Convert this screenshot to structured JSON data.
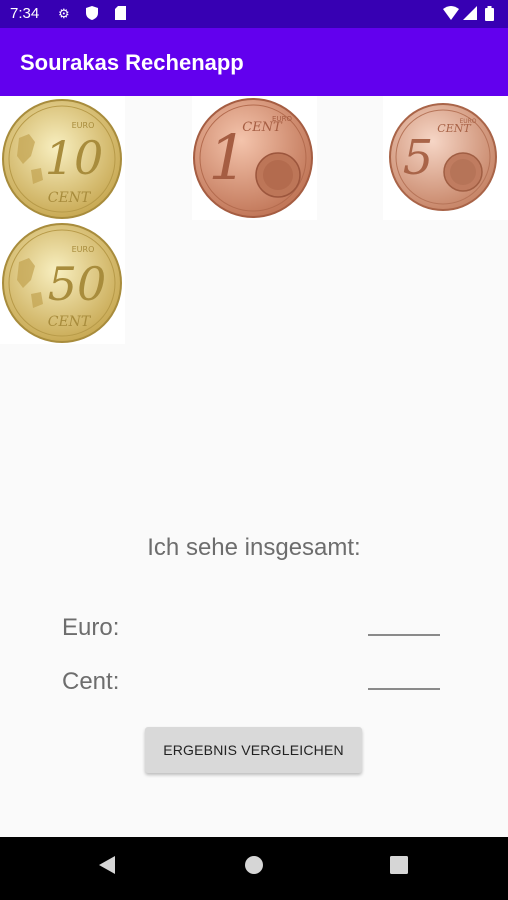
{
  "status_bar": {
    "time": "7:34",
    "left_icons": [
      "gear-icon",
      "shield-icon",
      "sd-card-icon"
    ],
    "right_icons": [
      "wifi-icon",
      "signal-icon",
      "battery-icon"
    ]
  },
  "app_bar": {
    "title": "Sourakas Rechenapp"
  },
  "coins": [
    {
      "label": "10",
      "sub": "CENT",
      "kind": "gold"
    },
    {
      "label": "1",
      "sub": "CENT",
      "kind": "copper"
    },
    {
      "label": "5",
      "sub": "CENT",
      "kind": "copper"
    },
    {
      "label": "50",
      "sub": "CENT",
      "kind": "gold"
    }
  ],
  "coin_mark": "EURO",
  "form": {
    "question": "Ich sehe insgesamt:",
    "euro_label": "Euro:",
    "euro_value": "",
    "cent_label": "Cent:",
    "cent_value": "",
    "compare_button": "ERGEBNIS VERGLEICHEN"
  },
  "nav_bar": {
    "buttons": [
      "back-icon",
      "home-icon",
      "recents-icon"
    ]
  },
  "colors": {
    "status_bar": "#3700b3",
    "app_bar": "#6200ee",
    "gold": "#e3cf7c",
    "copper": "#d48f72"
  }
}
